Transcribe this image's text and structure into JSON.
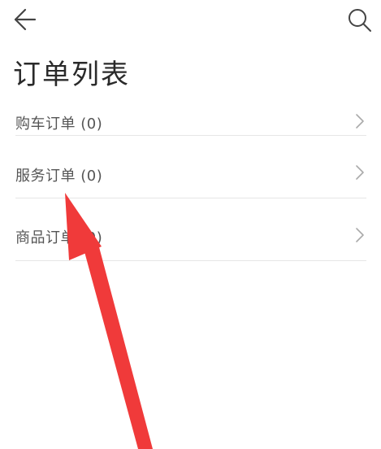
{
  "header": {
    "back_icon": "arrow-left-icon",
    "search_icon": "search-icon"
  },
  "page": {
    "title": "订单列表"
  },
  "orders": [
    {
      "label": "购车订单 (0)"
    },
    {
      "label": "服务订单 (0)"
    },
    {
      "label": "商品订单 (0)"
    }
  ],
  "colors": {
    "annotation_arrow": "#f03a3a",
    "divider": "#e6e6e6",
    "text": "#555555"
  }
}
